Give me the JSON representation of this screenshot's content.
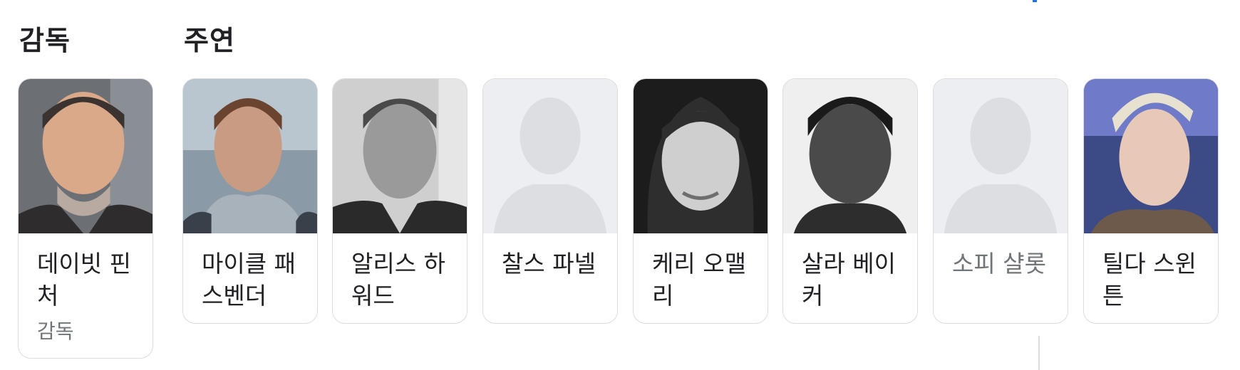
{
  "director_section": {
    "title": "감독",
    "people": [
      {
        "name": "데이빗 핀처",
        "role": "감독",
        "photo": "director-portrait"
      }
    ]
  },
  "cast_section": {
    "title": "주연",
    "people": [
      {
        "name": "마이클 패스벤더",
        "photo": "actor-portrait"
      },
      {
        "name": "알리스 하워드",
        "photo": "actor-portrait"
      },
      {
        "name": "찰스 파넬",
        "photo": "placeholder-avatar"
      },
      {
        "name": "케리 오맬리",
        "photo": "actor-portrait"
      },
      {
        "name": "살라 베이커",
        "photo": "actor-portrait"
      },
      {
        "name": "소피 샬롯",
        "photo": "placeholder-avatar"
      },
      {
        "name": "틸다 스윈튼",
        "photo": "actor-portrait"
      }
    ]
  },
  "colors": {
    "card_border": "#dadce0",
    "text": "#202124",
    "muted_text": "#70757a",
    "placeholder_bg": "#eceef1",
    "placeholder_silhouette": "#dcdee2",
    "accent": "#1a73e8"
  }
}
